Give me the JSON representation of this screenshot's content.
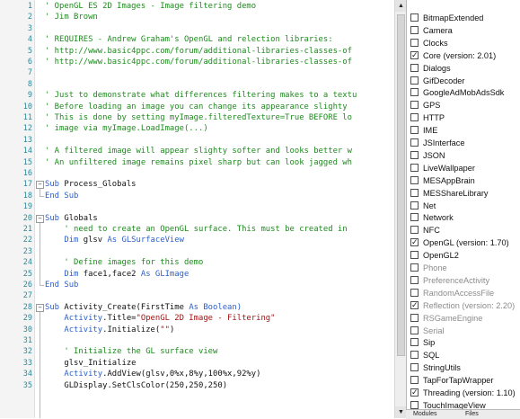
{
  "code_lines": [
    {
      "n": "1",
      "parts": [
        {
          "t": "' OpenGL ES 2D Images - Image filtering demo",
          "c": "cmt"
        }
      ]
    },
    {
      "n": "2",
      "parts": [
        {
          "t": "' Jim Brown",
          "c": "cmt"
        }
      ]
    },
    {
      "n": "3",
      "parts": []
    },
    {
      "n": "4",
      "parts": [
        {
          "t": "' REQUIRES - Andrew Graham's OpenGL and relection libraries:",
          "c": "cmt"
        }
      ]
    },
    {
      "n": "5",
      "parts": [
        {
          "t": "' http://www.basic4ppc.com/forum/additional-libraries-classes-of",
          "c": "cmt"
        }
      ]
    },
    {
      "n": "6",
      "parts": [
        {
          "t": "' http://www.basic4ppc.com/forum/additional-libraries-classes-of",
          "c": "cmt"
        }
      ]
    },
    {
      "n": "7",
      "parts": []
    },
    {
      "n": "8",
      "parts": []
    },
    {
      "n": "9",
      "parts": [
        {
          "t": "' Just to demonstrate what differences filtering makes to a textu",
          "c": "cmt"
        }
      ]
    },
    {
      "n": "10",
      "parts": [
        {
          "t": "' Before loading an image you can change its appearance slighty",
          "c": "cmt"
        }
      ]
    },
    {
      "n": "11",
      "parts": [
        {
          "t": "' This is done by setting myImage.filteredTexture=True BEFORE lo",
          "c": "cmt"
        }
      ]
    },
    {
      "n": "12",
      "parts": [
        {
          "t": "' image via myImage.LoadImage(...)",
          "c": "cmt"
        }
      ]
    },
    {
      "n": "13",
      "parts": []
    },
    {
      "n": "14",
      "parts": [
        {
          "t": "' A filtered image will appear slighty softer and looks better w",
          "c": "cmt"
        }
      ]
    },
    {
      "n": "15",
      "parts": [
        {
          "t": "' An unfiltered image remains pixel sharp but can look jagged wh",
          "c": "cmt"
        }
      ]
    },
    {
      "n": "16",
      "parts": []
    },
    {
      "n": "17",
      "parts": [
        {
          "t": "Sub",
          "c": "kw"
        },
        {
          "t": " Process_Globals",
          "c": "plain"
        }
      ]
    },
    {
      "n": "18",
      "parts": [
        {
          "t": "End Sub",
          "c": "kw"
        }
      ]
    },
    {
      "n": "19",
      "parts": []
    },
    {
      "n": "20",
      "parts": [
        {
          "t": "Sub",
          "c": "kw"
        },
        {
          "t": " Globals",
          "c": "plain"
        }
      ]
    },
    {
      "n": "21",
      "parts": [
        {
          "t": "    ' need to create an OpenGL surface. This must be created in",
          "c": "cmt"
        }
      ]
    },
    {
      "n": "22",
      "parts": [
        {
          "t": "    Dim",
          "c": "kw"
        },
        {
          "t": " glsv ",
          "c": "plain"
        },
        {
          "t": "As",
          "c": "kw"
        },
        {
          "t": " GLSurfaceView",
          "c": "kw"
        }
      ]
    },
    {
      "n": "23",
      "parts": []
    },
    {
      "n": "24",
      "parts": [
        {
          "t": "    ' Define images for this demo",
          "c": "cmt"
        }
      ]
    },
    {
      "n": "25",
      "parts": [
        {
          "t": "    Dim",
          "c": "kw"
        },
        {
          "t": " face1,face2 ",
          "c": "plain"
        },
        {
          "t": "As",
          "c": "kw"
        },
        {
          "t": " GLImage",
          "c": "kw"
        }
      ]
    },
    {
      "n": "26",
      "parts": [
        {
          "t": "End Sub",
          "c": "kw"
        }
      ]
    },
    {
      "n": "27",
      "parts": []
    },
    {
      "n": "28",
      "parts": [
        {
          "t": "Sub",
          "c": "kw"
        },
        {
          "t": " Activity_Create(FirstTime ",
          "c": "plain"
        },
        {
          "t": "As",
          "c": "kw"
        },
        {
          "t": " Boolean)",
          "c": "kw"
        }
      ]
    },
    {
      "n": "29",
      "parts": [
        {
          "t": "    Activity",
          "c": "kw"
        },
        {
          "t": ".Title=",
          "c": "plain"
        },
        {
          "t": "\"OpenGL 2D Image - Filtering\"",
          "c": "str"
        }
      ]
    },
    {
      "n": "30",
      "parts": [
        {
          "t": "    Activity",
          "c": "kw"
        },
        {
          "t": ".Initialize(",
          "c": "plain"
        },
        {
          "t": "\"\"",
          "c": "str"
        },
        {
          "t": ")",
          "c": "plain"
        }
      ]
    },
    {
      "n": "31",
      "parts": []
    },
    {
      "n": "32",
      "parts": [
        {
          "t": "    ' Initialize the GL surface view",
          "c": "cmt"
        }
      ]
    },
    {
      "n": "33",
      "parts": [
        {
          "t": "    glsv_Initialize",
          "c": "plain"
        }
      ]
    },
    {
      "n": "34",
      "parts": [
        {
          "t": "    Activity",
          "c": "kw"
        },
        {
          "t": ".AddView(glsv,0%x,8%y,100%x,92%y)",
          "c": "plain"
        }
      ]
    },
    {
      "n": "35",
      "parts": [
        {
          "t": "    GLDisplay.SetClsColor(250,250,250)",
          "c": "plain"
        }
      ]
    }
  ],
  "libraries": [
    {
      "label": "BitmapExtended",
      "checked": false,
      "dim": false
    },
    {
      "label": "Camera",
      "checked": false,
      "dim": false
    },
    {
      "label": "Clocks",
      "checked": false,
      "dim": false
    },
    {
      "label": "Core (version: 2.01)",
      "checked": true,
      "dim": false
    },
    {
      "label": "Dialogs",
      "checked": false,
      "dim": false
    },
    {
      "label": "GifDecoder",
      "checked": false,
      "dim": false
    },
    {
      "label": "GoogleAdMobAdsSdk",
      "checked": false,
      "dim": false
    },
    {
      "label": "GPS",
      "checked": false,
      "dim": false
    },
    {
      "label": "HTTP",
      "checked": false,
      "dim": false
    },
    {
      "label": "IME",
      "checked": false,
      "dim": false
    },
    {
      "label": "JSInterface",
      "checked": false,
      "dim": false
    },
    {
      "label": "JSON",
      "checked": false,
      "dim": false
    },
    {
      "label": "LiveWallpaper",
      "checked": false,
      "dim": false
    },
    {
      "label": "MESAppBrain",
      "checked": false,
      "dim": false
    },
    {
      "label": "MESShareLibrary",
      "checked": false,
      "dim": false
    },
    {
      "label": "Net",
      "checked": false,
      "dim": false
    },
    {
      "label": "Network",
      "checked": false,
      "dim": false
    },
    {
      "label": "NFC",
      "checked": false,
      "dim": false
    },
    {
      "label": "OpenGL (version: 1.70)",
      "checked": true,
      "dim": false
    },
    {
      "label": "OpenGL2",
      "checked": false,
      "dim": false
    },
    {
      "label": "Phone",
      "checked": false,
      "dim": true
    },
    {
      "label": "PreferenceActivity",
      "checked": false,
      "dim": true
    },
    {
      "label": "RandomAccessFile",
      "checked": false,
      "dim": true
    },
    {
      "label": "Reflection (version: 2.20)",
      "checked": true,
      "dim": true
    },
    {
      "label": "RSGameEngine",
      "checked": false,
      "dim": true
    },
    {
      "label": "Serial",
      "checked": false,
      "dim": true
    },
    {
      "label": "Sip",
      "checked": false,
      "dim": false
    },
    {
      "label": "SQL",
      "checked": false,
      "dim": false
    },
    {
      "label": "StringUtils",
      "checked": false,
      "dim": false
    },
    {
      "label": "TapForTapWrapper",
      "checked": false,
      "dim": false
    },
    {
      "label": "Threading (version: 1.10)",
      "checked": true,
      "dim": false
    },
    {
      "label": "TouchImageView",
      "checked": false,
      "dim": false
    }
  ],
  "bottom_tabs": [
    "Modules",
    "Files"
  ],
  "icons": {
    "scroll_up": "arrow-up-icon",
    "scroll_down": "arrow-down-icon",
    "fold": "fold-toggle-icon",
    "check": "checkmark-icon"
  },
  "colors": {
    "comment": "#1e8a1e",
    "keyword": "#2c5fc9",
    "string": "#a31515",
    "line_number": "#2b8a9a"
  }
}
